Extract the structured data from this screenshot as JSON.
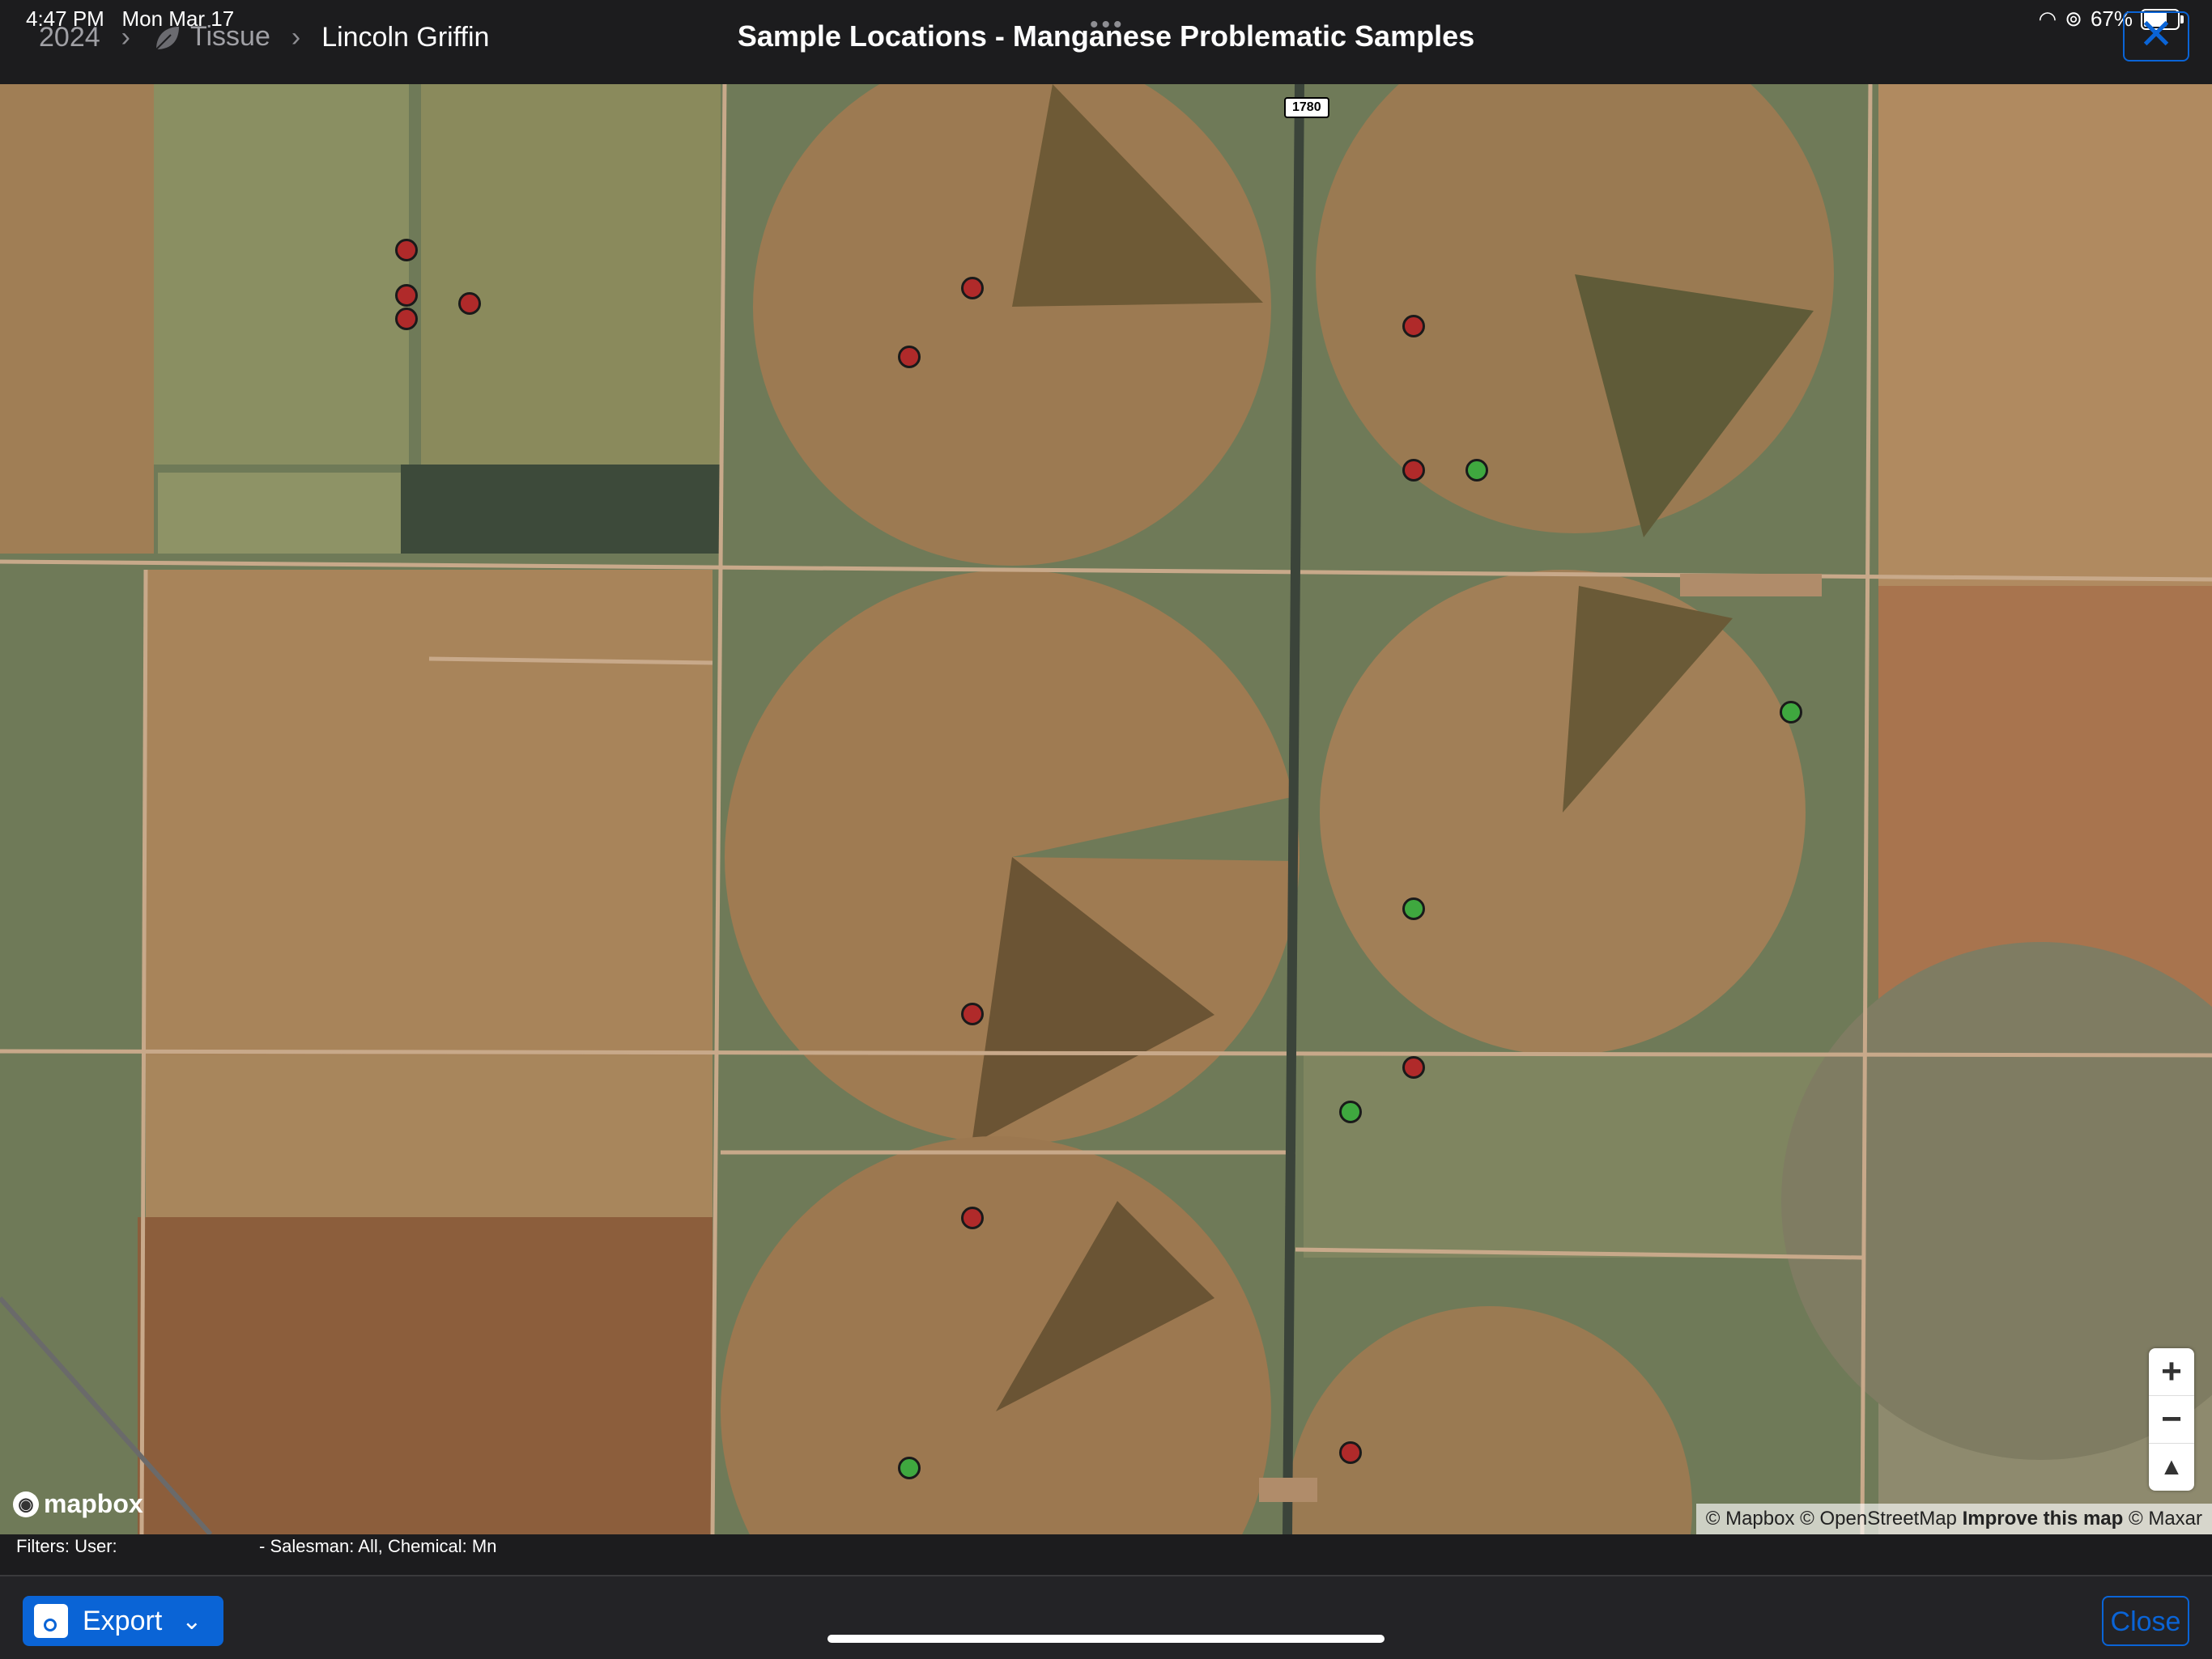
{
  "status_bar": {
    "time": "4:47 PM",
    "date": "Mon Mar 17",
    "battery": "67%"
  },
  "breadcrumb": {
    "year": "2024",
    "category": "Tissue",
    "grower": "Lincoln Griffin"
  },
  "page_title": "Sample Locations - Manganese Problematic Samples",
  "top_close_icon": "close-icon",
  "map": {
    "road_label": "1780",
    "logo_text": "mapbox",
    "attribution": {
      "mapbox": "© Mapbox",
      "osm": "© OpenStreetMap",
      "improve": "Improve this map",
      "maxar": "© Maxar"
    },
    "marker_colors": {
      "problem": "#b02a2a",
      "ok": "#3fa83f"
    },
    "marker_counts": {
      "problem": 13,
      "ok": 5
    },
    "zoom_in": "+",
    "zoom_out": "−",
    "compass": "▲"
  },
  "filters": {
    "label": "Filters: User:",
    "value": "- Salesman: All, Chemical: Mn"
  },
  "bottom": {
    "export_label": "Export",
    "close_label": "Close"
  },
  "colors": {
    "accent": "#0a64d6",
    "bar_bg": "#1c1c1e"
  }
}
